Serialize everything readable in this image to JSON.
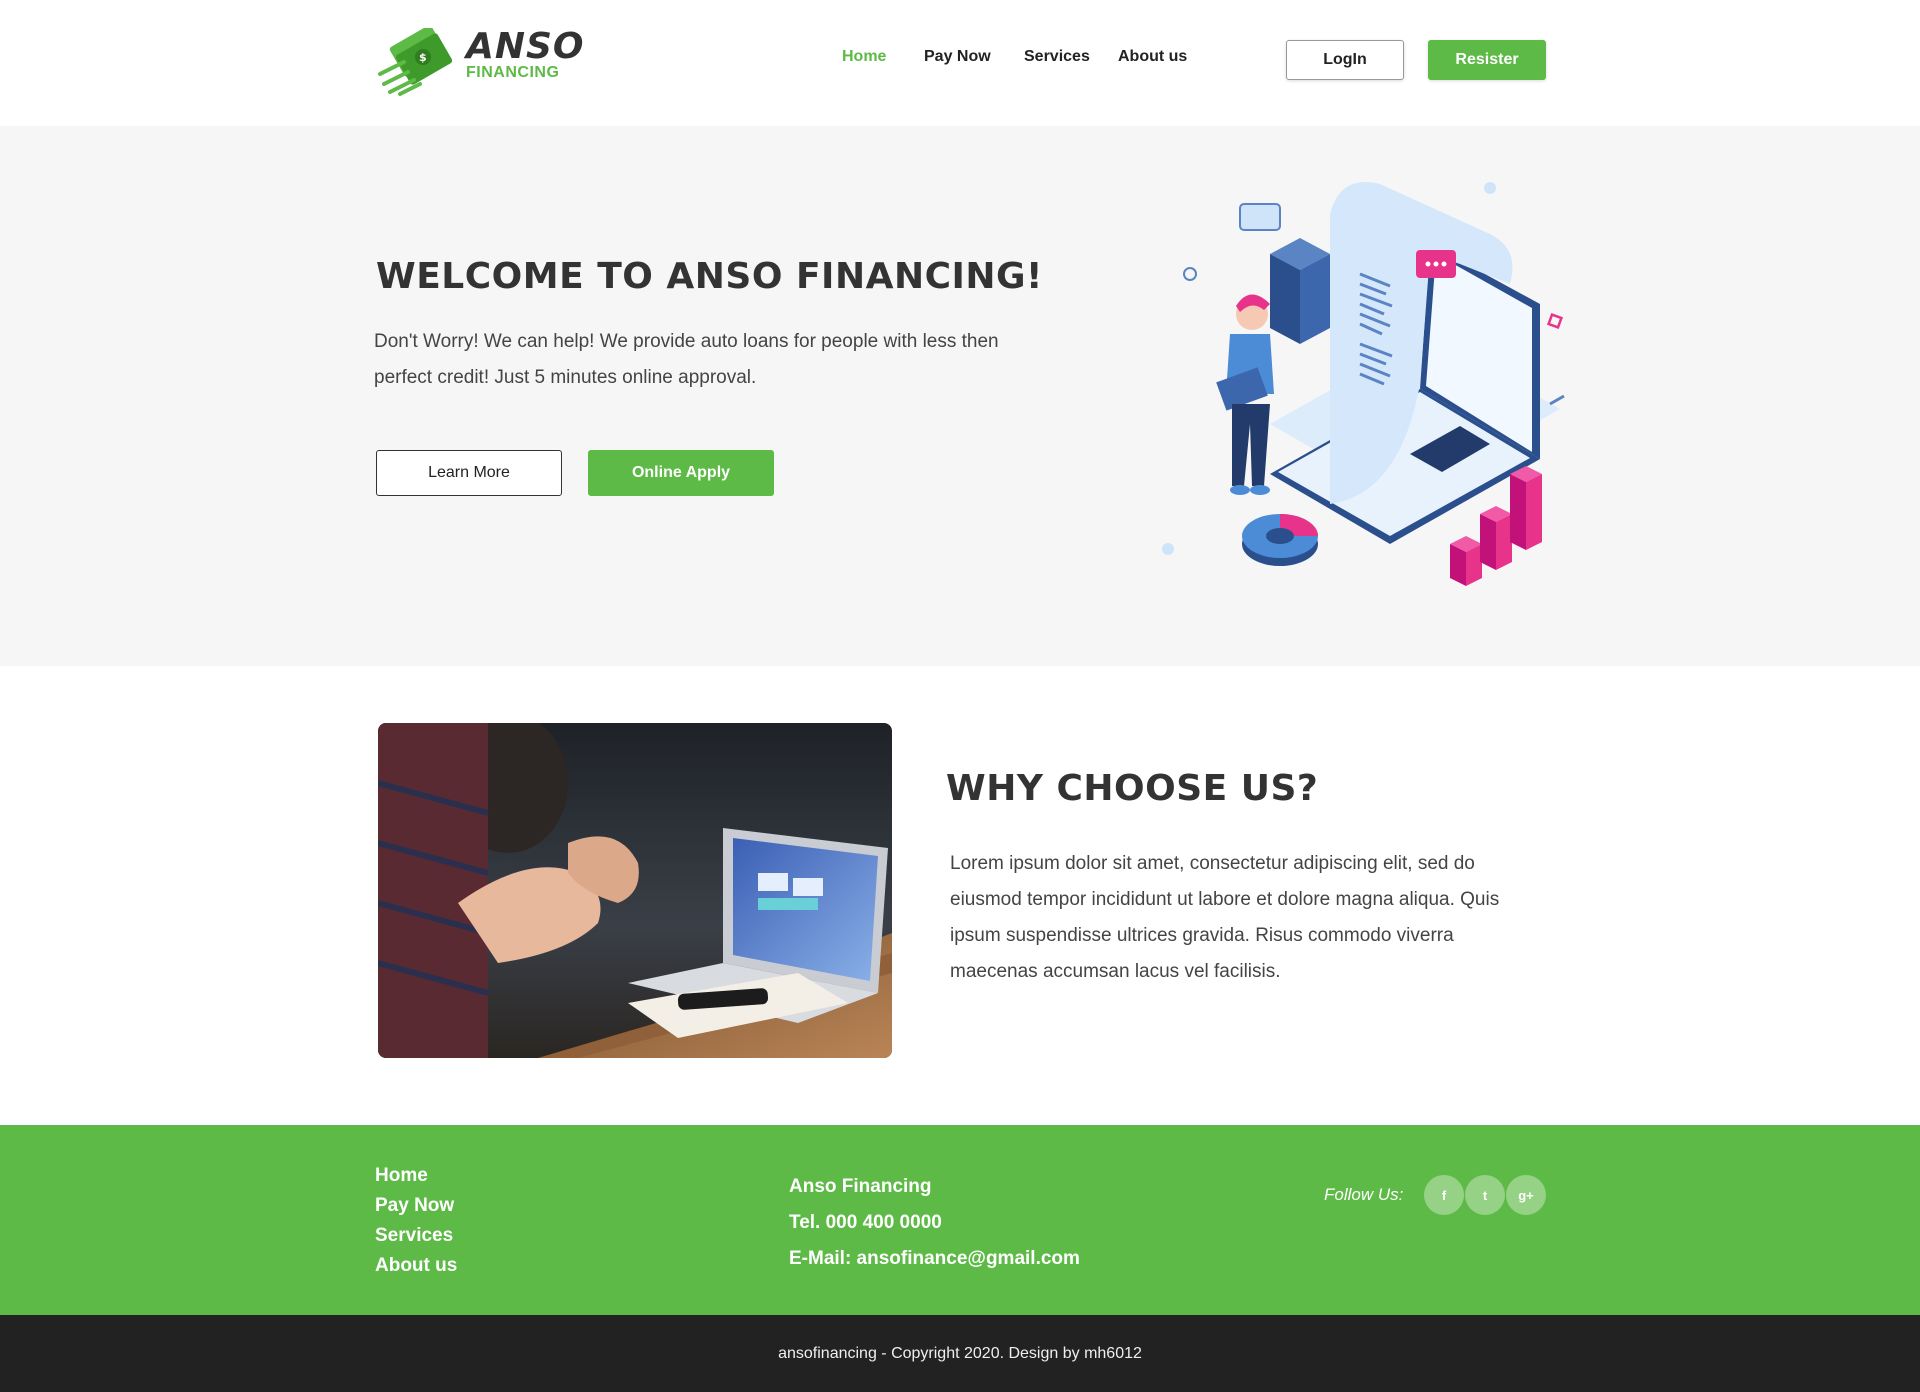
{
  "brand": {
    "name": "ANSO",
    "sub": "FINANCING",
    "accent": "#5dba46",
    "dark": "#333333"
  },
  "nav": {
    "items": [
      {
        "label": "Home",
        "active": true
      },
      {
        "label": "Pay Now",
        "active": false
      },
      {
        "label": "Services",
        "active": false
      },
      {
        "label": "About us",
        "active": false
      }
    ],
    "login": "LogIn",
    "register": "Resister"
  },
  "hero": {
    "title": "WELCOME TO ANSO FINANCING!",
    "text": "Don't Worry! We can help! We provide auto loans for people with less then perfect credit! Just 5 minutes online approval.",
    "learn_more": "Learn More",
    "online_apply": "Online Apply"
  },
  "why": {
    "title": "WHY CHOOSE US?",
    "text": "Lorem ipsum dolor sit amet, consectetur adipiscing elit, sed do eiusmod tempor incididunt ut labore et dolore magna aliqua. Quis ipsum suspendisse ultrices gravida. Risus commodo viverra maecenas accumsan lacus vel facilisis."
  },
  "footer": {
    "links": [
      "Home",
      "Pay Now",
      "Services",
      "About us"
    ],
    "company": "Anso Financing",
    "tel": "Tel. 000 400 0000",
    "email": "E-Mail: ansofinance@gmail.com",
    "follow": "Follow Us:",
    "social": [
      {
        "icon": "facebook-icon",
        "glyph": "f"
      },
      {
        "icon": "twitter-icon",
        "glyph": "t"
      },
      {
        "icon": "google-plus-icon",
        "glyph": "g+"
      }
    ]
  },
  "copyright": "ansofinancing - Copyright 2020. Design by mh6012"
}
